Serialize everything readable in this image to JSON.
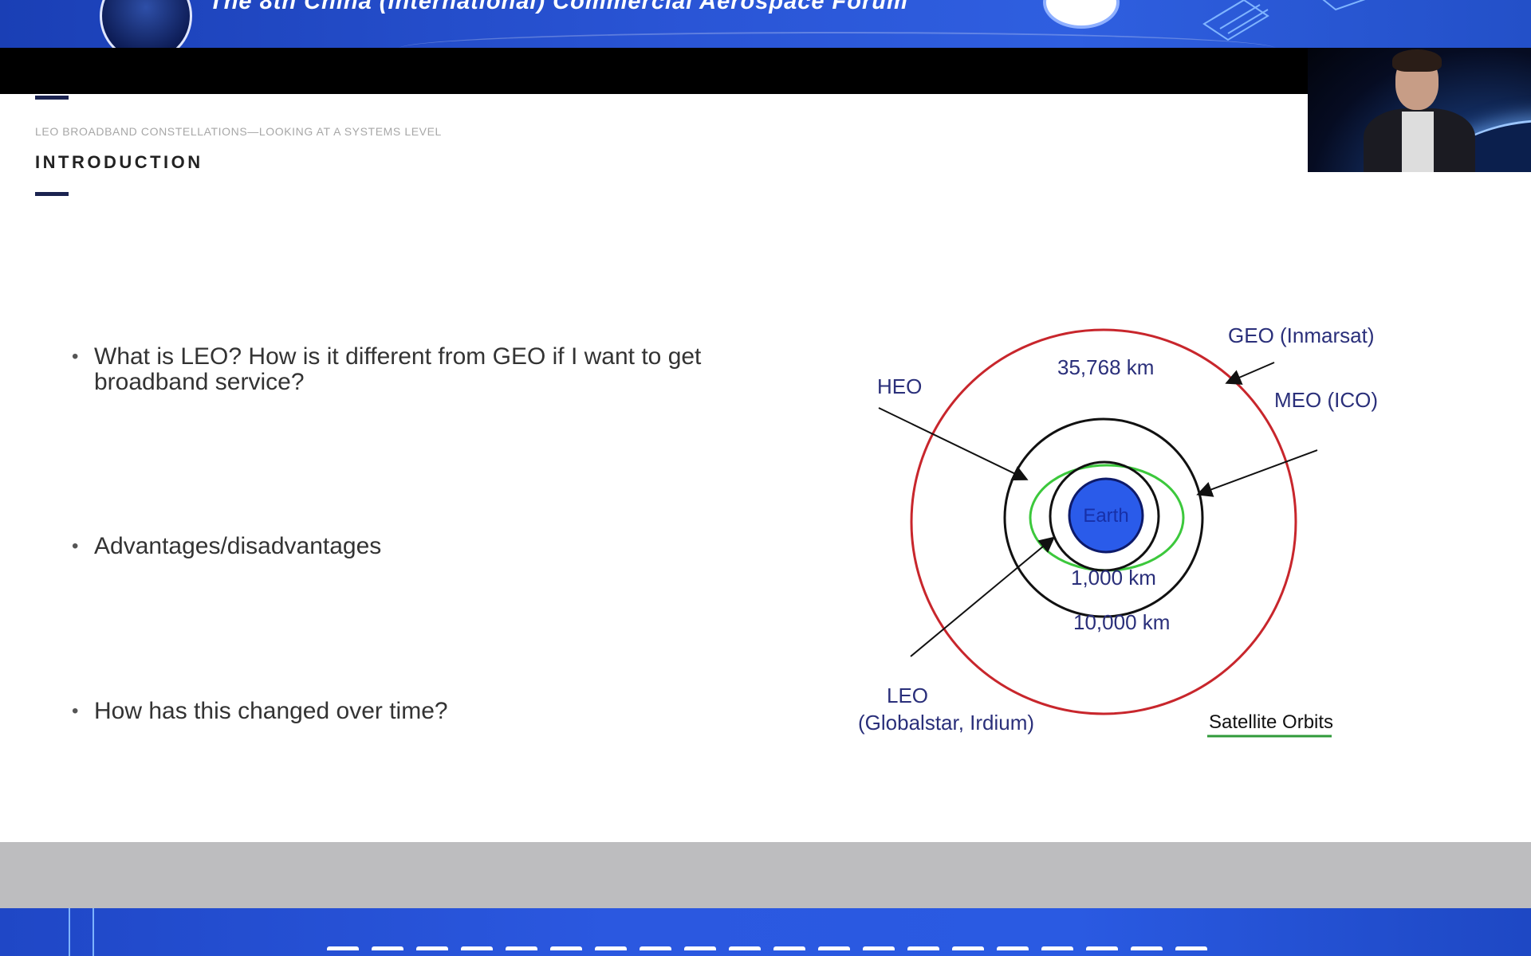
{
  "top_banner": {
    "title": "The 8th China (International) Commercial Aerospace Forum"
  },
  "slide": {
    "subtitle": "LEO BROADBAND CONSTELLATIONS—LOOKING AT A SYSTEMS LEVEL",
    "title": "INTRODUCTION",
    "bullets": [
      "What is LEO? How is it different from GEO if I want to get broadband service?",
      "Advantages/disadvantages",
      "How has this changed over time?"
    ]
  },
  "diagram": {
    "labels": {
      "geo": "GEO (Inmarsat)",
      "geo_altitude": "35,768 km",
      "heo": "HEO",
      "meo": "MEO (ICO)",
      "earth": "Earth",
      "leo_altitude": "1,000 km",
      "meo_altitude": "10,000 km",
      "leo": "LEO",
      "leo_examples": "(Globalstar, Irdium)",
      "caption": "Satellite Orbits"
    },
    "colors": {
      "geo_orbit": "#c8262c",
      "heo_orbit": "#3cc83c",
      "meo_orbit": "#111111",
      "earth_fill": "#2a5bea",
      "label_text": "#2a2f7a",
      "caption_underline": "#2f9a3a"
    }
  },
  "colors": {
    "banner_blue": "#2a55d6",
    "accent_navy": "#1b2350",
    "grey_band": "#bdbdbf"
  }
}
